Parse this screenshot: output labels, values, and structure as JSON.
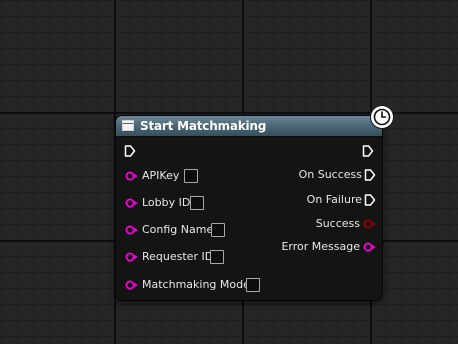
{
  "node": {
    "title": "Start Matchmaking",
    "header_color": "#4e6878",
    "latent_icon": "clock-icon",
    "inputs": [
      {
        "label": "APIKey",
        "pin": "string-pin-icon",
        "checked": false
      },
      {
        "label": "Lobby ID",
        "pin": "string-pin-icon",
        "checked": false
      },
      {
        "label": "Config Name",
        "pin": "string-pin-icon",
        "checked": false
      },
      {
        "label": "Requester ID",
        "pin": "string-pin-icon",
        "checked": false
      },
      {
        "label": "Matchmaking Mode",
        "pin": "string-pin-icon",
        "checked": false
      }
    ],
    "outputs": [
      {
        "label": "On Success",
        "pin": "exec-pin-icon"
      },
      {
        "label": "On Failure",
        "pin": "exec-pin-icon"
      },
      {
        "label": "Success",
        "pin": "bool-pin-icon"
      },
      {
        "label": "Error Message",
        "pin": "string-pin-icon"
      }
    ],
    "pin_colors": {
      "string": "#f700d8",
      "bool": "#950101",
      "exec": "#ffffff"
    }
  }
}
